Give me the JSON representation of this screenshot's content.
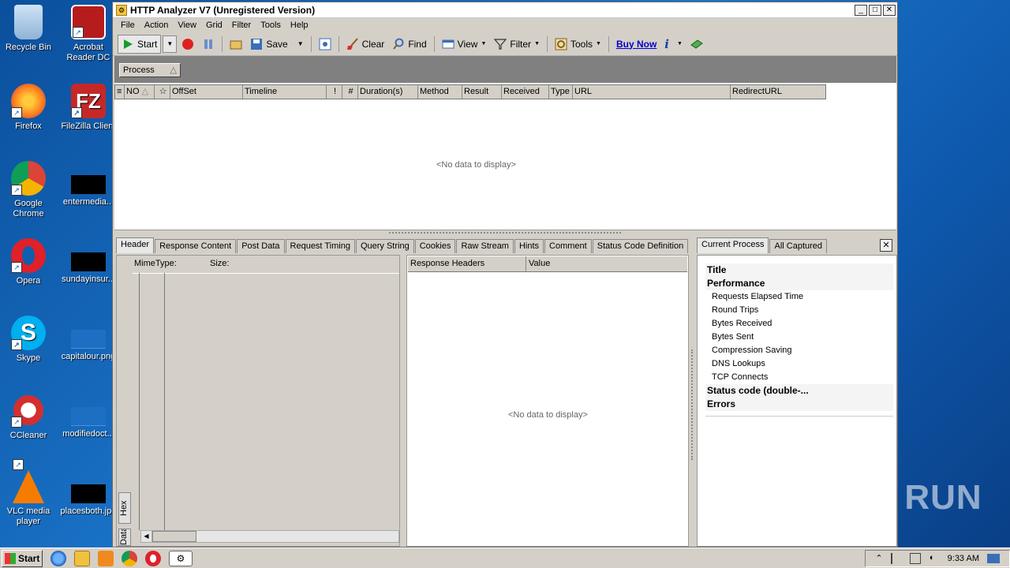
{
  "desktop": {
    "icons": [
      {
        "label": "Recycle Bin",
        "icon": "recycle-bin-icon"
      },
      {
        "label": "Acrobat Reader DC",
        "icon": "acrobat-reader-icon"
      },
      {
        "label": "Firefox",
        "icon": "firefox-icon"
      },
      {
        "label": "FileZilla Client",
        "icon": "filezilla-icon"
      },
      {
        "label": "Google Chrome",
        "icon": "chrome-icon"
      },
      {
        "label": "entermedia...",
        "icon": "file-thumbnail-icon"
      },
      {
        "label": "Opera",
        "icon": "opera-icon"
      },
      {
        "label": "sundayinsur...",
        "icon": "file-thumbnail-icon"
      },
      {
        "label": "Skype",
        "icon": "skype-icon"
      },
      {
        "label": "capitalour.png",
        "icon": "file-thumbnail-icon"
      },
      {
        "label": "CCleaner",
        "icon": "ccleaner-icon"
      },
      {
        "label": "modifiedoct...",
        "icon": "file-thumbnail-icon"
      },
      {
        "label": "VLC media player",
        "icon": "vlc-icon"
      },
      {
        "label": "placesboth.jpg",
        "icon": "file-thumbnail-icon"
      }
    ]
  },
  "window": {
    "title": "HTTP Analyzer V7  (Unregistered Version)",
    "minimize": "_",
    "maximize": "□",
    "close": "✕"
  },
  "menu": [
    "File",
    "Action",
    "View",
    "Grid",
    "Filter",
    "Tools",
    "Help"
  ],
  "toolbar": {
    "start": "Start",
    "save": "Save",
    "clear": "Clear",
    "find": "Find",
    "view": "View",
    "filter": "Filter",
    "tools": "Tools",
    "buy_now": "Buy Now",
    "info": "i"
  },
  "grid": {
    "group_button": "Process",
    "sort_glyph": "△",
    "columns": [
      "",
      "NO",
      "",
      "OffSet",
      "Timeline",
      "!",
      "#",
      "Duration(s)",
      "Method",
      "Result",
      "Received",
      "Type",
      "URL",
      "RedirectURL"
    ],
    "empty": "<No data to display>"
  },
  "detail_tabs": [
    "Header",
    "Response Content",
    "Post Data",
    "Request Timing",
    "Query String",
    "Cookies",
    "Raw Stream",
    "Hints",
    "Comment",
    "Status Code Definition"
  ],
  "left_pane": {
    "mime_label": "MimeType:",
    "size_label": "Size:",
    "side_tabs": [
      "Hex",
      "Data"
    ]
  },
  "mid_pane": {
    "columns": [
      "Response Headers",
      "Value"
    ],
    "empty": "<No data to display>"
  },
  "right_pane": {
    "tabs": [
      "Current Process",
      "All Captured"
    ],
    "close": "✕",
    "tree": [
      {
        "text": "Title",
        "kind": "cat"
      },
      {
        "text": "Performance",
        "kind": "cat"
      },
      {
        "text": "Requests Elapsed Time",
        "kind": "sub"
      },
      {
        "text": "Round Trips",
        "kind": "sub"
      },
      {
        "text": "Bytes Received",
        "kind": "sub"
      },
      {
        "text": "Bytes Sent",
        "kind": "sub"
      },
      {
        "text": "Compression Saving",
        "kind": "sub"
      },
      {
        "text": "DNS Lookups",
        "kind": "sub"
      },
      {
        "text": "TCP Connects",
        "kind": "sub"
      },
      {
        "text": "Status code (double-...",
        "kind": "cat"
      },
      {
        "text": "Errors",
        "kind": "cat"
      }
    ]
  },
  "watermark": "ANY RUN",
  "taskbar": {
    "start": "Start",
    "clock": "9:33 AM"
  }
}
